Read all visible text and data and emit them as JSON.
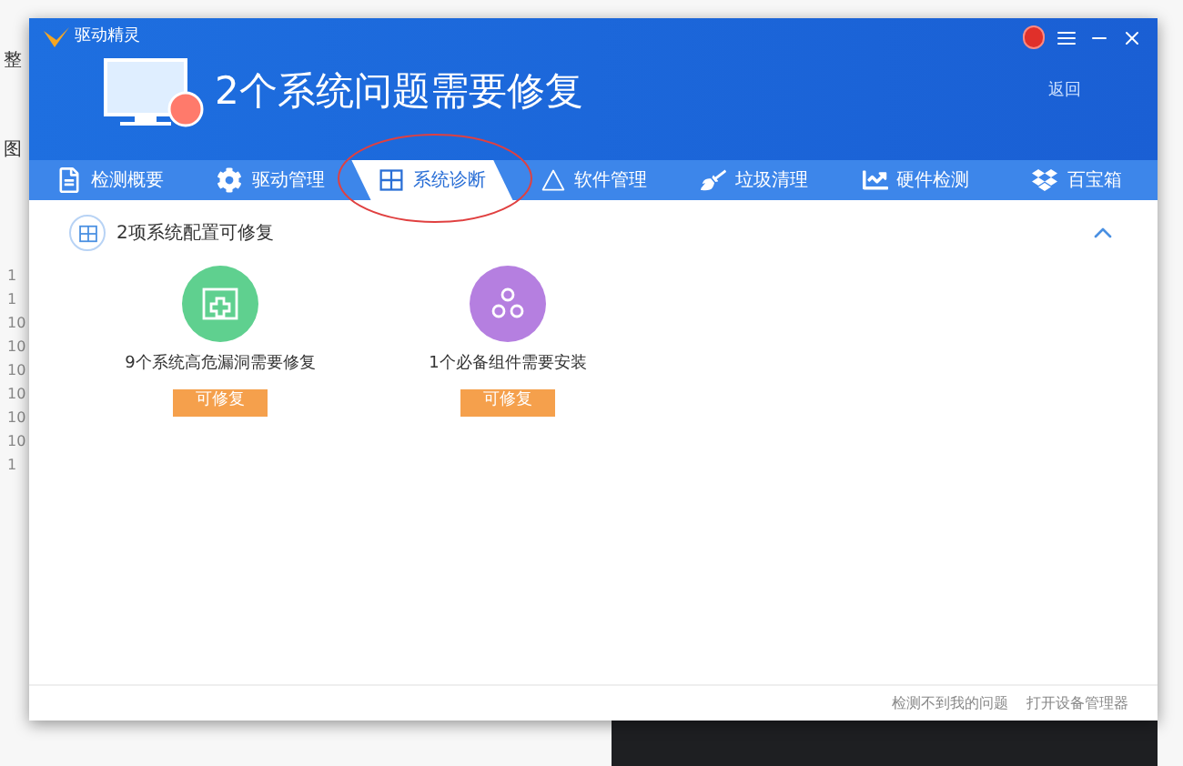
{
  "background": {
    "cells": [
      "整",
      "图"
    ],
    "row_numbers": [
      "1",
      "1",
      "10",
      "10",
      "10",
      "10",
      "10",
      "10",
      "1"
    ]
  },
  "window": {
    "app_name": "驱动精灵",
    "headline": "2个系统问题需要修复",
    "back_link": "返回"
  },
  "tabs": [
    {
      "label": "检测概要",
      "selected": false,
      "kind": "doc"
    },
    {
      "label": "驱动管理",
      "selected": false,
      "kind": "gear"
    },
    {
      "label": "系统诊断",
      "selected": true,
      "kind": "window"
    },
    {
      "label": "软件管理",
      "selected": false,
      "kind": "triangle"
    },
    {
      "label": "垃圾清理",
      "selected": false,
      "kind": "broom"
    },
    {
      "label": "硬件检测",
      "selected": false,
      "kind": "monitor"
    },
    {
      "label": "百宝箱",
      "selected": false,
      "kind": "box"
    }
  ],
  "section": {
    "title": "2项系统配置可修复",
    "expanded": true
  },
  "items": [
    {
      "kind": "vulnerability",
      "color": "#5fd08f",
      "text": "9个系统高危漏洞需要修复",
      "button": "可修复"
    },
    {
      "kind": "component",
      "color": "#b57fe0",
      "text": "1个必备组件需要安装",
      "button": "可修复"
    }
  ],
  "footer": {
    "links": [
      "检测不到我的问题",
      "打开设备管理器"
    ]
  }
}
